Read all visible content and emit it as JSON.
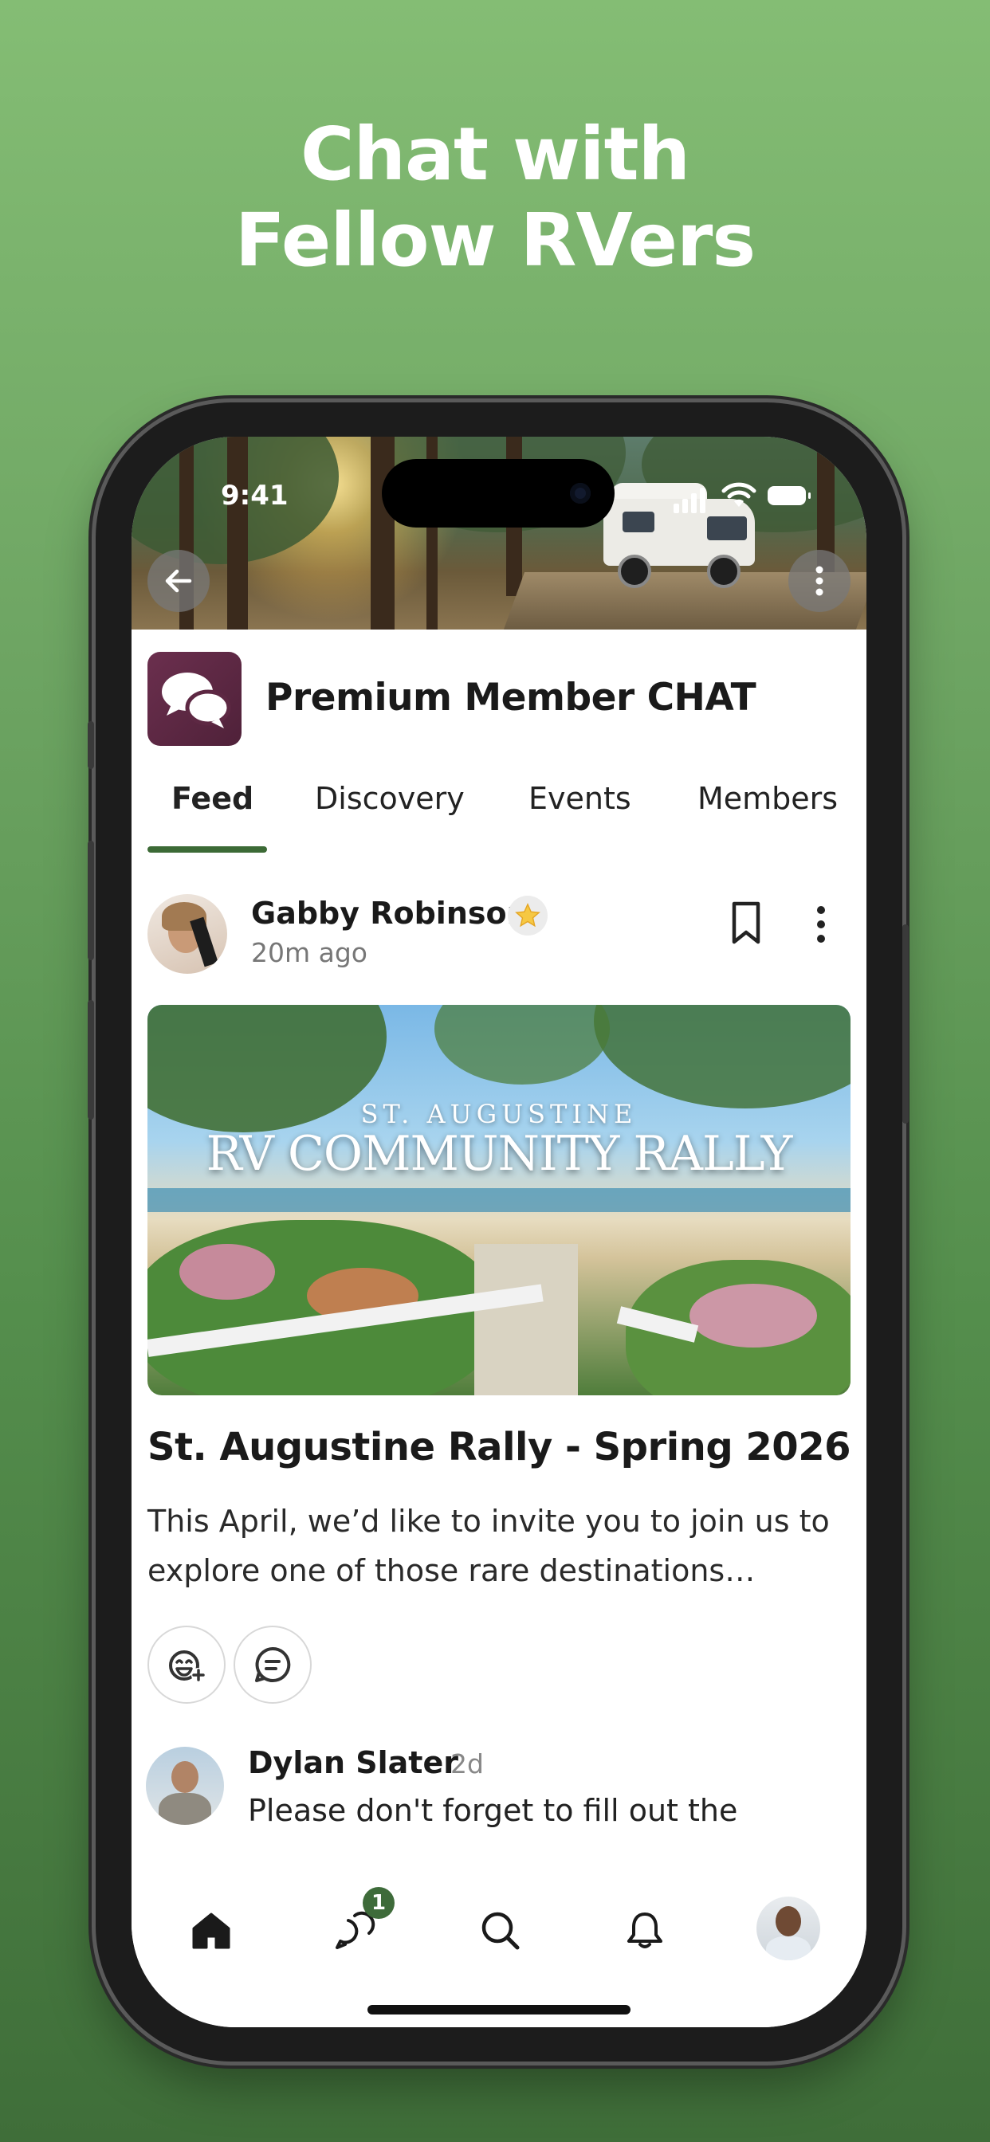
{
  "headline": {
    "line1": "Chat with",
    "line2": "Fellow RVers"
  },
  "status_bar": {
    "time": "9:41"
  },
  "banner": {
    "back_icon": "arrow-left-icon",
    "menu_icon": "more-vertical-icon"
  },
  "group": {
    "title": "Premium Member CHAT",
    "icon": "chat-bubbles-icon",
    "icon_color": "#5d2843"
  },
  "tabs": [
    {
      "label": "Feed",
      "active": true
    },
    {
      "label": "Discovery",
      "active": false
    },
    {
      "label": "Events",
      "active": false
    },
    {
      "label": "Members",
      "active": false
    }
  ],
  "post": {
    "author": "Gabby Robinson",
    "time": "20m ago",
    "badge_icon": "star-icon",
    "image_text_small": "ST. AUGUSTINE",
    "image_text_big": "RV COMMUNITY RALLY",
    "title": "St. Augustine Rally - Spring 2026",
    "body": "This April, we’d like to invite you to join us to explore one of those rare destinations…"
  },
  "comment": {
    "author": "Dylan Slater",
    "time": "2d",
    "text": "Please don't forget to fill out the"
  },
  "tabbar": {
    "chat_badge": "1"
  },
  "colors": {
    "accent": "#3c6a36",
    "background_top": "#84bd74",
    "background_bottom": "#3f6e39"
  }
}
